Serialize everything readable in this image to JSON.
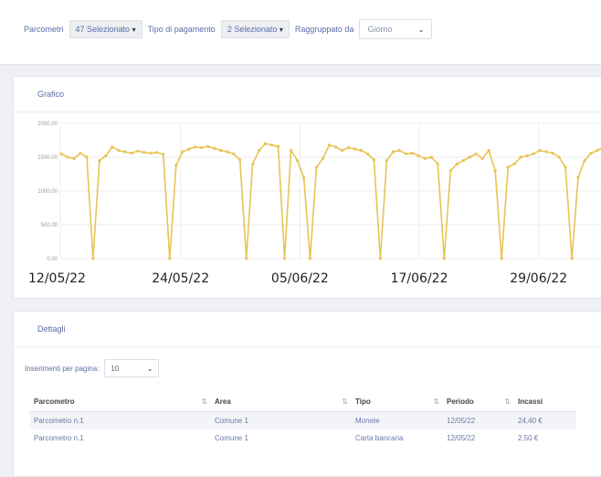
{
  "filters": {
    "parcometri_label": "Parcometri",
    "parcometri_value": "47 Selezionato",
    "tipo_label": "Tipo di pagamento",
    "tipo_value": "2 Selezionato",
    "raggruppato_label": "Raggruppato da",
    "raggruppato_value": "Giorno"
  },
  "chart_panel": {
    "title": "Grafico"
  },
  "chart_data": {
    "type": "line",
    "ylim": [
      0,
      2000
    ],
    "yticks": [
      "0.00",
      "500.00",
      "1000.00",
      "1500.00",
      "2000.00"
    ],
    "xticks": [
      "12/05/22",
      "24/05/22",
      "05/06/22",
      "17/06/22",
      "29/06/22"
    ],
    "color": "#e8c454",
    "series": [
      {
        "values": [
          1550,
          1500,
          1480,
          1560,
          1500,
          0,
          1450,
          1520,
          1650,
          1600,
          1580,
          1560,
          1590,
          1570,
          1560,
          1570,
          1540,
          0,
          1380,
          1580,
          1620,
          1650,
          1640,
          1660,
          1630,
          1600,
          1580,
          1550,
          1460,
          0,
          1400,
          1600,
          1700,
          1680,
          1660,
          0,
          1600,
          1450,
          1200,
          0,
          1350,
          1480,
          1680,
          1650,
          1600,
          1640,
          1620,
          1600,
          1550,
          1460,
          0,
          1450,
          1580,
          1600,
          1550,
          1560,
          1520,
          1480,
          1500,
          1400,
          0,
          1300,
          1400,
          1450,
          1500,
          1550,
          1480,
          1600,
          1300,
          0,
          1350,
          1400,
          1500,
          1520,
          1550,
          1600,
          1580,
          1560,
          1500,
          1350,
          0,
          1200,
          1450,
          1560,
          1600,
          1650
        ]
      }
    ]
  },
  "detail_panel": {
    "title": "Dettagli",
    "perpage_label": "Inserimenti per pagina:",
    "perpage_value": "10"
  },
  "table": {
    "headers": [
      "Parcometro",
      "Area",
      "Tipo",
      "Periodo",
      "Incassi"
    ],
    "rows": [
      [
        "Parcometro n.1",
        "Comune 1",
        "Monete",
        "12/05/22",
        "24,40 €"
      ],
      [
        "Parcometro n.1",
        "Comune 1",
        "Carta bancaria",
        "12/05/22",
        "2,50 €"
      ]
    ]
  }
}
